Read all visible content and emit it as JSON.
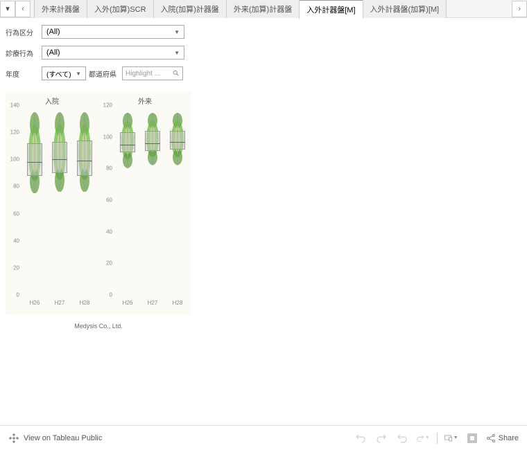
{
  "tabs": {
    "items": [
      {
        "label": "外来計器盤"
      },
      {
        "label": "入外(加算)SCR"
      },
      {
        "label": "入院(加算)計器盤"
      },
      {
        "label": "外来(加算)計器盤"
      },
      {
        "label": "入外計器盤[M]"
      },
      {
        "label": "入外計器盤(加算)[M]"
      }
    ],
    "active_index": 4
  },
  "filters": {
    "koui_kubun": {
      "label": "行為区分",
      "value": "(All)"
    },
    "shinryo_koui": {
      "label": "診療行為",
      "value": "(All)"
    },
    "nendo": {
      "label": "年度",
      "value": "(すべて)"
    },
    "todofuken": {
      "label": "都道府県",
      "placeholder": "Highlight ..."
    }
  },
  "chart_data": [
    {
      "type": "boxplot",
      "title": "入院",
      "categories": [
        "H26",
        "H27",
        "H28"
      ],
      "ylim": [
        0,
        140
      ],
      "yticks": [
        0,
        20,
        40,
        60,
        80,
        100,
        120,
        140
      ],
      "series": [
        {
          "category": "H26",
          "min": 75,
          "q1": 88,
          "median": 98,
          "q3": 112,
          "max": 135
        },
        {
          "category": "H27",
          "min": 76,
          "q1": 90,
          "median": 100,
          "q3": 113,
          "max": 135
        },
        {
          "category": "H28",
          "min": 76,
          "q1": 88,
          "median": 99,
          "q3": 114,
          "max": 135
        }
      ]
    },
    {
      "type": "boxplot",
      "title": "外来",
      "categories": [
        "H26",
        "H27",
        "H28"
      ],
      "ylim": [
        0,
        120
      ],
      "yticks": [
        0,
        20,
        40,
        60,
        80,
        100,
        120
      ],
      "series": [
        {
          "category": "H26",
          "min": 80,
          "q1": 90,
          "median": 95,
          "q3": 103,
          "max": 115
        },
        {
          "category": "H27",
          "min": 82,
          "q1": 91,
          "median": 96,
          "q3": 104,
          "max": 115
        },
        {
          "category": "H28",
          "min": 82,
          "q1": 92,
          "median": 97,
          "q3": 104,
          "max": 115
        }
      ]
    }
  ],
  "attribution": "Medysis Co., Ltd.",
  "footer": {
    "view_label": "View on Tableau Public",
    "share_label": "Share"
  }
}
